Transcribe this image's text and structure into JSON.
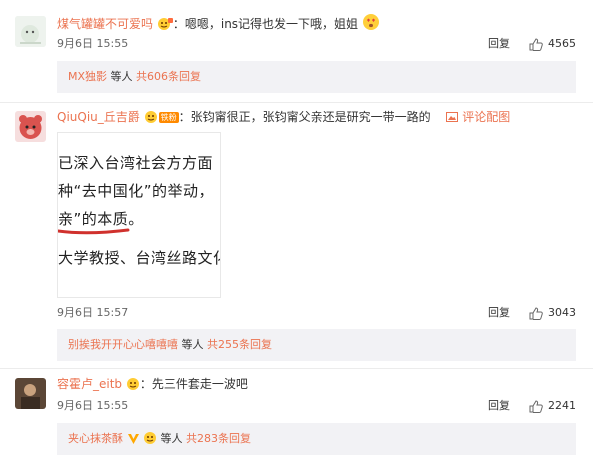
{
  "comments": [
    {
      "username": "煤气罐罐不可爱吗",
      "colon": "：",
      "text": "嗯嗯，ins记得也发一下哦，姐姐",
      "time": "9月6日 15:55",
      "reply_label": "回复",
      "likes": "4565",
      "sub": {
        "user": "MX独影",
        "middle": "等人",
        "count": "共606条回复"
      }
    },
    {
      "username": "QiuQiu_丘吉爵",
      "badge_text": "铁粉",
      "colon": "：",
      "text": "张钧甯很正，张钧甯父亲还是研究一带一路的",
      "pic_label": "评论配图",
      "image_lines": [
        "已深入台湾社会方方面",
        "种“去中国化”的举动，",
        "亲”的本质。",
        "大学教授、台湾丝路文化"
      ],
      "time": "9月6日 15:57",
      "reply_label": "回复",
      "likes": "3043",
      "sub": {
        "user": "别挨我开开心心嘻嘻嘻",
        "middle": "等人",
        "count": "共255条回复"
      }
    },
    {
      "username": "容霍卢_eitb",
      "colon": "：",
      "text": "先三件套走一波吧",
      "time": "9月6日 15:55",
      "reply_label": "回复",
      "likes": "2241",
      "sub": {
        "user": "夹心抹茶酥",
        "middle": "等人",
        "count": "共283条回复"
      }
    }
  ],
  "colors": {
    "link": "#eb7350",
    "subbox_bg": "#f2f2f5"
  }
}
